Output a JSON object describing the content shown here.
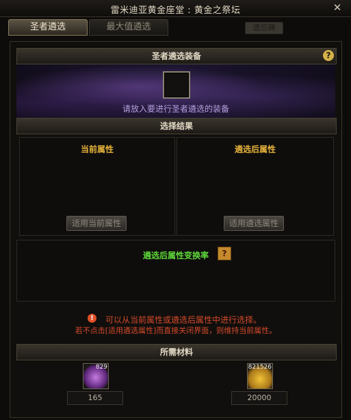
{
  "window": {
    "title": "雷米迪亚黄金座堂 : 黄金之祭坛"
  },
  "tabs": [
    {
      "label": "圣者遴选"
    },
    {
      "label": "最大值遴选"
    },
    {
      "label": "遗忘碑"
    }
  ],
  "equip_section": {
    "header": "圣者遴选装备",
    "hint": "请放入要进行圣者遴选的装备"
  },
  "results_section": {
    "header": "选择结果",
    "current": {
      "title": "当前属性",
      "button": "适用当前属性"
    },
    "after": {
      "title": "遴选后属性",
      "button": "适用遴选属性"
    },
    "conversion_title": "遴选后属性变换率"
  },
  "warnings": {
    "line1": "可以从当前属性或遴选后属性中进行选择。",
    "line2": "若不点击[适用遴选属性]而直接关闭界面，则维持当前属性。"
  },
  "materials_section": {
    "header": "所需材料",
    "items": [
      {
        "name": "purple-gem",
        "count_badge": "829",
        "required": "165"
      },
      {
        "name": "gold-coins",
        "count_badge": "821526",
        "required": "20000"
      }
    ]
  },
  "colors": {
    "gold": "#e6b23c",
    "green": "#5fd93a",
    "warning": "#d6492a",
    "purple_hint": "#b5a0e0"
  }
}
